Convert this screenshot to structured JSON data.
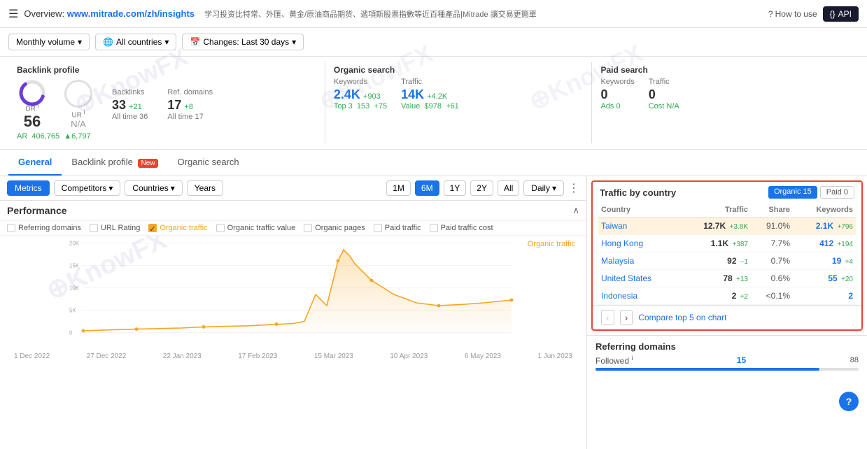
{
  "nav": {
    "title": "Overview:",
    "url": "www.mitrade.com/zh/insights",
    "subtitle": "学习投资比特常、外匯、黄金/原油商品期货、遞項斯股票指數等近百種產品|Mitrade 讓交易更簡單",
    "how_to_use": "How to use",
    "api": "API"
  },
  "filters": {
    "monthly_volume": "Monthly volume",
    "all_countries": "All countries",
    "changes": "Changes: Last 30 days"
  },
  "backlink_profile": {
    "title": "Backlink profile",
    "dr_label": "DR",
    "dr_value": "56",
    "ur_label": "UR",
    "ur_value": "N/A",
    "backlinks_label": "Backlinks",
    "backlinks_value": "33",
    "backlinks_delta": "+21",
    "backlinks_sub": "All time 36",
    "ref_domains_label": "Ref. domains",
    "ref_domains_value": "17",
    "ref_domains_delta": "+8",
    "ref_domains_sub": "All time 17",
    "ar_label": "AR",
    "ar_value": "406,765",
    "ar_delta": "▲6,797"
  },
  "organic_search": {
    "title": "Organic search",
    "keywords_label": "Keywords",
    "keywords_value": "2.4K",
    "keywords_delta": "+903",
    "traffic_label": "Traffic",
    "traffic_value": "14K",
    "traffic_delta": "+4.2K",
    "top3_label": "Top 3",
    "top3_value": "153",
    "top3_delta": "+75",
    "value_label": "Value",
    "value_value": "$978",
    "value_delta": "+61"
  },
  "paid_search": {
    "title": "Paid search",
    "keywords_label": "Keywords",
    "keywords_value": "0",
    "traffic_label": "Traffic",
    "traffic_value": "0",
    "ads_label": "Ads",
    "ads_value": "0",
    "cost_label": "Cost",
    "cost_value": "N/A"
  },
  "tabs": [
    {
      "label": "General",
      "active": true,
      "badge": null
    },
    {
      "label": "Backlink profile",
      "active": false,
      "badge": "New"
    },
    {
      "label": "Organic search",
      "active": false,
      "badge": null
    }
  ],
  "metrics_bar": {
    "metrics": "Metrics",
    "competitors": "Competitors",
    "countries": "Countries",
    "years": "Years",
    "time_periods": [
      "1M",
      "6M",
      "1Y",
      "2Y",
      "All"
    ],
    "active_period": "6M",
    "daily": "Daily"
  },
  "performance": {
    "title": "Performance",
    "checkboxes": [
      {
        "label": "Referring domains",
        "checked": false,
        "color": null
      },
      {
        "label": "URL Rating",
        "checked": false,
        "color": null
      },
      {
        "label": "Organic traffic",
        "checked": true,
        "color": "orange"
      },
      {
        "label": "Organic traffic value",
        "checked": false,
        "color": null
      },
      {
        "label": "Organic pages",
        "checked": false,
        "color": null
      },
      {
        "label": "Paid traffic",
        "checked": false,
        "color": null
      },
      {
        "label": "Paid traffic cost",
        "checked": false,
        "color": null
      }
    ],
    "organic_traffic_label": "Organic traffic",
    "y_labels": [
      "20K",
      "15K",
      "10K",
      "5K",
      "0"
    ],
    "x_labels": [
      "1 Dec 2022",
      "27 Dec 2022",
      "22 Jan 2023",
      "17 Feb 2023",
      "15 Mar 2023",
      "10 Apr 2023",
      "6 May 2023",
      "1 Jun 2023"
    ]
  },
  "traffic_by_country": {
    "title": "Traffic by country",
    "organic_label": "Organic",
    "organic_count": "15",
    "paid_label": "Paid",
    "paid_count": "0",
    "columns": [
      "Country",
      "Traffic",
      "Share",
      "Keywords"
    ],
    "rows": [
      {
        "country": "Taiwan",
        "traffic": "12.7K",
        "delta": "+3.8K",
        "share": "91.0%",
        "kw": "2.1K",
        "kw_delta": "+796",
        "highlighted": true
      },
      {
        "country": "Hong Kong",
        "traffic": "1.1K",
        "delta": "+387",
        "share": "7.7%",
        "kw": "412",
        "kw_delta": "+194",
        "highlighted": false
      },
      {
        "country": "Malaysia",
        "traffic": "92",
        "delta": "–1",
        "share": "0.7%",
        "kw": "19",
        "kw_delta": "+4",
        "highlighted": false
      },
      {
        "country": "United States",
        "traffic": "78",
        "delta": "+13",
        "share": "0.6%",
        "kw": "55",
        "kw_delta": "+20",
        "highlighted": false
      },
      {
        "country": "Indonesia",
        "traffic": "2",
        "delta": "+2",
        "share": "<0.1%",
        "kw": "2",
        "kw_delta": "",
        "highlighted": false
      }
    ],
    "compare_label": "Compare top 5 on chart"
  },
  "referring_domains": {
    "title": "Referring domains",
    "followed_label": "Followed",
    "followed_value": "15",
    "followed_pct": 85
  },
  "watermarks": [
    "KnowFX",
    "KnowFX",
    "KnowFX"
  ]
}
